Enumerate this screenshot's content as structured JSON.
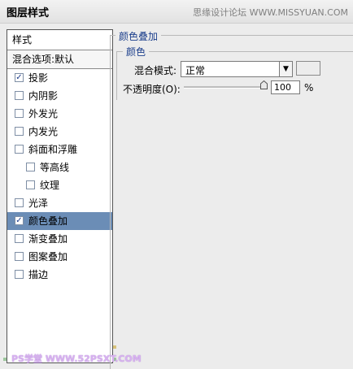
{
  "window": {
    "title": "图层样式",
    "watermark": "思缘设计论坛 WWW.MISSYUAN.COM"
  },
  "styles": {
    "header": "样式",
    "blend_options": "混合选项:默认",
    "items": [
      {
        "label": "投影",
        "checked": true,
        "selected": false,
        "sub": false
      },
      {
        "label": "内阴影",
        "checked": false,
        "selected": false,
        "sub": false
      },
      {
        "label": "外发光",
        "checked": false,
        "selected": false,
        "sub": false
      },
      {
        "label": "内发光",
        "checked": false,
        "selected": false,
        "sub": false
      },
      {
        "label": "斜面和浮雕",
        "checked": false,
        "selected": false,
        "sub": false
      },
      {
        "label": "等高线",
        "checked": false,
        "selected": false,
        "sub": true
      },
      {
        "label": "纹理",
        "checked": false,
        "selected": false,
        "sub": true
      },
      {
        "label": "光泽",
        "checked": false,
        "selected": false,
        "sub": false
      },
      {
        "label": "颜色叠加",
        "checked": true,
        "selected": true,
        "sub": false
      },
      {
        "label": "渐变叠加",
        "checked": false,
        "selected": false,
        "sub": false
      },
      {
        "label": "图案叠加",
        "checked": false,
        "selected": false,
        "sub": false
      },
      {
        "label": "描边",
        "checked": false,
        "selected": false,
        "sub": false
      }
    ]
  },
  "overlay": {
    "section_title": "颜色叠加",
    "subsection_title": "颜色",
    "blend_mode_label": "混合模式:",
    "blend_mode_value": "正常",
    "opacity_label": "不透明度(O):",
    "opacity_value": "100",
    "opacity_unit": "%",
    "opacity_fraction": 1.0,
    "swatch_color": "#ececec"
  },
  "footer": {
    "watermark": "PS学堂 WWW.52PSXT.COM"
  },
  "colors": {
    "selection": "#6b8db6",
    "group_title": "#1c3f8c"
  }
}
